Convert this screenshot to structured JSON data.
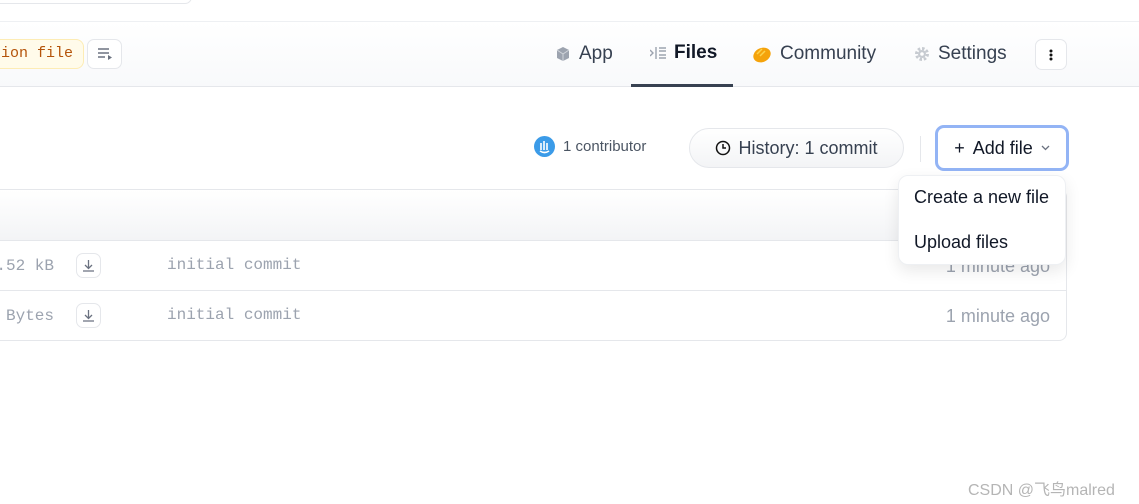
{
  "header": {
    "pill_label": "ion file",
    "tabs": [
      {
        "label": "App",
        "icon": "cube-icon"
      },
      {
        "label": "Files",
        "icon": "files-icon",
        "active": true
      },
      {
        "label": "Community",
        "icon": "clap-icon"
      },
      {
        "label": "Settings",
        "icon": "gear-icon"
      }
    ]
  },
  "toolbar": {
    "contributors": "1 contributor",
    "history": "History: 1 commit",
    "add_file": "Add file"
  },
  "menu": {
    "items": [
      "Create a new file",
      "Upload files"
    ]
  },
  "files": [
    {
      "size": ".52 kB",
      "message": "initial commit",
      "time": "1 minute ago"
    },
    {
      "size": "Bytes",
      "message": "initial commit",
      "time": "1 minute ago"
    }
  ],
  "watermark": "CSDN @飞鸟malred",
  "colors": {
    "accent_focus": "#93b4f5",
    "pill_text": "#b45309",
    "clap": "#f5a30b",
    "contrib": "#3b9be8"
  }
}
